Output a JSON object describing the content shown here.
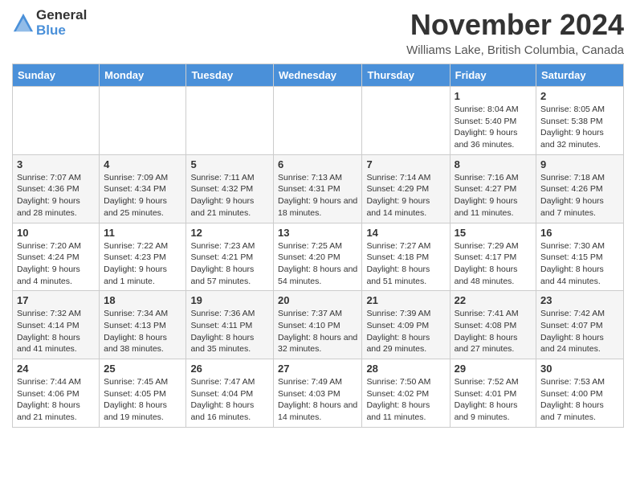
{
  "logo": {
    "general": "General",
    "blue": "Blue"
  },
  "title": "November 2024",
  "location": "Williams Lake, British Columbia, Canada",
  "days_header": [
    "Sunday",
    "Monday",
    "Tuesday",
    "Wednesday",
    "Thursday",
    "Friday",
    "Saturday"
  ],
  "weeks": [
    [
      {
        "num": "",
        "info": ""
      },
      {
        "num": "",
        "info": ""
      },
      {
        "num": "",
        "info": ""
      },
      {
        "num": "",
        "info": ""
      },
      {
        "num": "",
        "info": ""
      },
      {
        "num": "1",
        "info": "Sunrise: 8:04 AM\nSunset: 5:40 PM\nDaylight: 9 hours and 36 minutes."
      },
      {
        "num": "2",
        "info": "Sunrise: 8:05 AM\nSunset: 5:38 PM\nDaylight: 9 hours and 32 minutes."
      }
    ],
    [
      {
        "num": "3",
        "info": "Sunrise: 7:07 AM\nSunset: 4:36 PM\nDaylight: 9 hours and 28 minutes."
      },
      {
        "num": "4",
        "info": "Sunrise: 7:09 AM\nSunset: 4:34 PM\nDaylight: 9 hours and 25 minutes."
      },
      {
        "num": "5",
        "info": "Sunrise: 7:11 AM\nSunset: 4:32 PM\nDaylight: 9 hours and 21 minutes."
      },
      {
        "num": "6",
        "info": "Sunrise: 7:13 AM\nSunset: 4:31 PM\nDaylight: 9 hours and 18 minutes."
      },
      {
        "num": "7",
        "info": "Sunrise: 7:14 AM\nSunset: 4:29 PM\nDaylight: 9 hours and 14 minutes."
      },
      {
        "num": "8",
        "info": "Sunrise: 7:16 AM\nSunset: 4:27 PM\nDaylight: 9 hours and 11 minutes."
      },
      {
        "num": "9",
        "info": "Sunrise: 7:18 AM\nSunset: 4:26 PM\nDaylight: 9 hours and 7 minutes."
      }
    ],
    [
      {
        "num": "10",
        "info": "Sunrise: 7:20 AM\nSunset: 4:24 PM\nDaylight: 9 hours and 4 minutes."
      },
      {
        "num": "11",
        "info": "Sunrise: 7:22 AM\nSunset: 4:23 PM\nDaylight: 9 hours and 1 minute."
      },
      {
        "num": "12",
        "info": "Sunrise: 7:23 AM\nSunset: 4:21 PM\nDaylight: 8 hours and 57 minutes."
      },
      {
        "num": "13",
        "info": "Sunrise: 7:25 AM\nSunset: 4:20 PM\nDaylight: 8 hours and 54 minutes."
      },
      {
        "num": "14",
        "info": "Sunrise: 7:27 AM\nSunset: 4:18 PM\nDaylight: 8 hours and 51 minutes."
      },
      {
        "num": "15",
        "info": "Sunrise: 7:29 AM\nSunset: 4:17 PM\nDaylight: 8 hours and 48 minutes."
      },
      {
        "num": "16",
        "info": "Sunrise: 7:30 AM\nSunset: 4:15 PM\nDaylight: 8 hours and 44 minutes."
      }
    ],
    [
      {
        "num": "17",
        "info": "Sunrise: 7:32 AM\nSunset: 4:14 PM\nDaylight: 8 hours and 41 minutes."
      },
      {
        "num": "18",
        "info": "Sunrise: 7:34 AM\nSunset: 4:13 PM\nDaylight: 8 hours and 38 minutes."
      },
      {
        "num": "19",
        "info": "Sunrise: 7:36 AM\nSunset: 4:11 PM\nDaylight: 8 hours and 35 minutes."
      },
      {
        "num": "20",
        "info": "Sunrise: 7:37 AM\nSunset: 4:10 PM\nDaylight: 8 hours and 32 minutes."
      },
      {
        "num": "21",
        "info": "Sunrise: 7:39 AM\nSunset: 4:09 PM\nDaylight: 8 hours and 29 minutes."
      },
      {
        "num": "22",
        "info": "Sunrise: 7:41 AM\nSunset: 4:08 PM\nDaylight: 8 hours and 27 minutes."
      },
      {
        "num": "23",
        "info": "Sunrise: 7:42 AM\nSunset: 4:07 PM\nDaylight: 8 hours and 24 minutes."
      }
    ],
    [
      {
        "num": "24",
        "info": "Sunrise: 7:44 AM\nSunset: 4:06 PM\nDaylight: 8 hours and 21 minutes."
      },
      {
        "num": "25",
        "info": "Sunrise: 7:45 AM\nSunset: 4:05 PM\nDaylight: 8 hours and 19 minutes."
      },
      {
        "num": "26",
        "info": "Sunrise: 7:47 AM\nSunset: 4:04 PM\nDaylight: 8 hours and 16 minutes."
      },
      {
        "num": "27",
        "info": "Sunrise: 7:49 AM\nSunset: 4:03 PM\nDaylight: 8 hours and 14 minutes."
      },
      {
        "num": "28",
        "info": "Sunrise: 7:50 AM\nSunset: 4:02 PM\nDaylight: 8 hours and 11 minutes."
      },
      {
        "num": "29",
        "info": "Sunrise: 7:52 AM\nSunset: 4:01 PM\nDaylight: 8 hours and 9 minutes."
      },
      {
        "num": "30",
        "info": "Sunrise: 7:53 AM\nSunset: 4:00 PM\nDaylight: 8 hours and 7 minutes."
      }
    ]
  ]
}
